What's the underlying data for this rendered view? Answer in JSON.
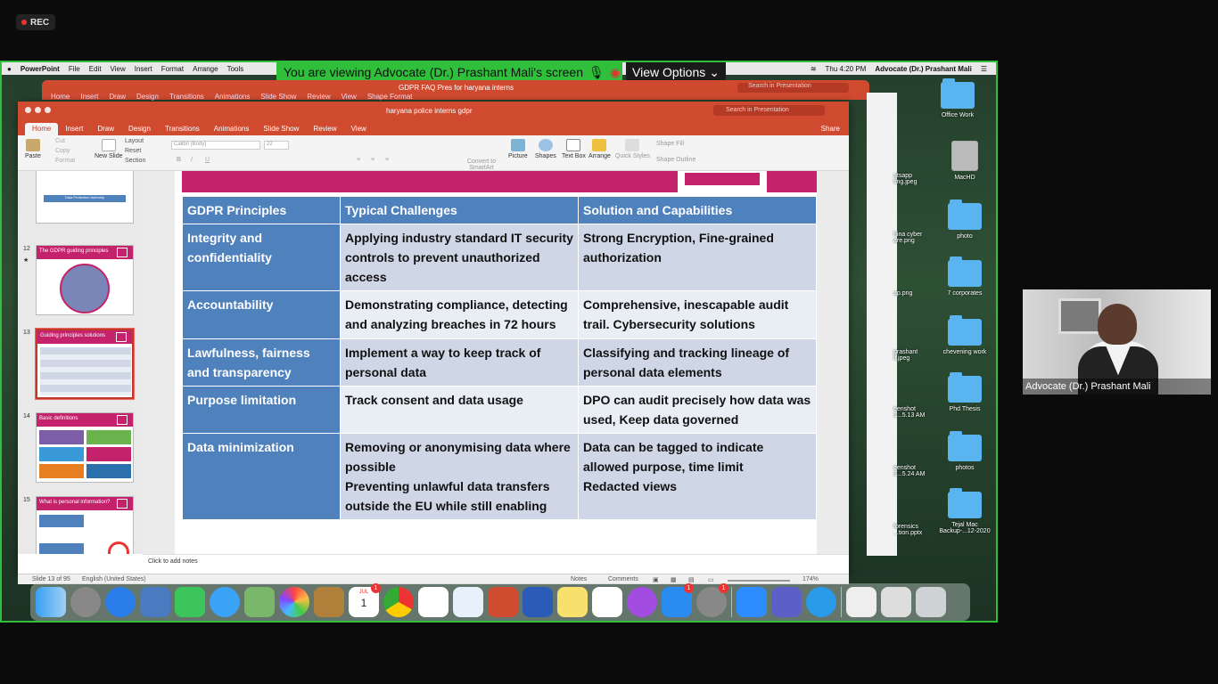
{
  "rec": {
    "label": "REC"
  },
  "mac_menu": {
    "app": "PowerPoint",
    "items": [
      "File",
      "Edit",
      "View",
      "Insert",
      "Format",
      "Arrange",
      "Tools"
    ],
    "clock": "Thu 4:20 PM",
    "user": "Advocate (Dr.) Prashant Mali"
  },
  "zoom": {
    "viewing": "You are viewing Advocate (Dr.) Prashant Mali's screen",
    "view_options": "View Options"
  },
  "back_window": {
    "title": "GDPR FAQ Pres for haryana interns",
    "tabs": [
      "Home",
      "Insert",
      "Draw",
      "Design",
      "Transitions",
      "Animations",
      "Slide Show",
      "Review",
      "View",
      "Shape Format"
    ],
    "search": "Search in Presentation",
    "share": "Share"
  },
  "window": {
    "title": "haryana police interns gdpr",
    "search": "Search in Presentation",
    "share": "Share",
    "tabs": [
      "Home",
      "Insert",
      "Draw",
      "Design",
      "Transitions",
      "Animations",
      "Slide Show",
      "Review",
      "View"
    ]
  },
  "ribbon": {
    "paste": "Paste",
    "cut": "Cut",
    "copy": "Copy",
    "format": "Format",
    "new_slide": "New Slide",
    "layout": "Layout",
    "reset": "Reset",
    "section": "Section",
    "font": "Calibri (Body)",
    "size": "22",
    "convert": "Convert to SmartArt",
    "picture": "Picture",
    "shapes": "Shapes",
    "text_box": "Text Box",
    "arrange": "Arrange",
    "quick_styles": "Quick Styles",
    "shape_fill": "Shape Fill",
    "shape_outline": "Shape Outline"
  },
  "thumbnails": [
    {
      "num": "",
      "title": "Data Protection Authority"
    },
    {
      "num": "12",
      "title": "The GDPR guiding principles"
    },
    {
      "num": "13",
      "title": "Guiding principles solutions"
    },
    {
      "num": "14",
      "title": "Basic definitions"
    },
    {
      "num": "15",
      "title": "What is personal information?"
    }
  ],
  "table": {
    "headers": [
      "GDPR Principles",
      "Typical Challenges",
      "Solution and Capabilities"
    ],
    "rows": [
      [
        "Integrity and confidentiality",
        "Applying industry standard IT security controls to prevent unauthorized access",
        "Strong Encryption, Fine-grained authorization"
      ],
      [
        "Accountability",
        "Demonstrating compliance, detecting and analyzing breaches in 72 hours",
        "Comprehensive, inescapable audit trail. Cybersecurity solutions"
      ],
      [
        "Lawfulness, fairness and transparency",
        "Implement a way to keep track of personal data",
        "Classifying and tracking lineage of personal data elements"
      ],
      [
        "Purpose limitation",
        "Track consent and data usage",
        "DPO can audit precisely how data was used, Keep data governed"
      ],
      [
        "Data minimization",
        "Removing or anonymising data where possible\nPreventing unlawful data transfers outside the EU while still enabling",
        "Data can be tagged to indicate allowed purpose, time limit\nRedacted views"
      ]
    ]
  },
  "notes": {
    "placeholder": "Click to add notes"
  },
  "status": {
    "slide": "Slide 13 of 95",
    "language": "English (United States)",
    "notes": "Notes",
    "comments": "Comments",
    "zoom": "174%"
  },
  "desktop": [
    {
      "label": "Office Work"
    },
    {
      "label": "MacHD"
    },
    {
      "label": "photo"
    },
    {
      "label": "7 corporates"
    },
    {
      "label": "chevening work"
    },
    {
      "label": "Phd Thesis"
    },
    {
      "label": "photos"
    },
    {
      "label": "Tejal Mac Backup-...12-2020"
    }
  ],
  "desktop_partial": [
    "atsapp ting.jpeg",
    "hina cyber are.png",
    "ap.png",
    "prashant li.jpeg",
    "eenshot 3...5.13 AM",
    "eenshot 3...5.24 AM",
    "forensics ...tion.pptx"
  ],
  "video": {
    "name": "Advocate (Dr.) Prashant Mali"
  },
  "dock_badges": {
    "calendar": "1",
    "appstore": "1",
    "settings": "1",
    "calendar_month": "JUL",
    "calendar_day": "1"
  }
}
